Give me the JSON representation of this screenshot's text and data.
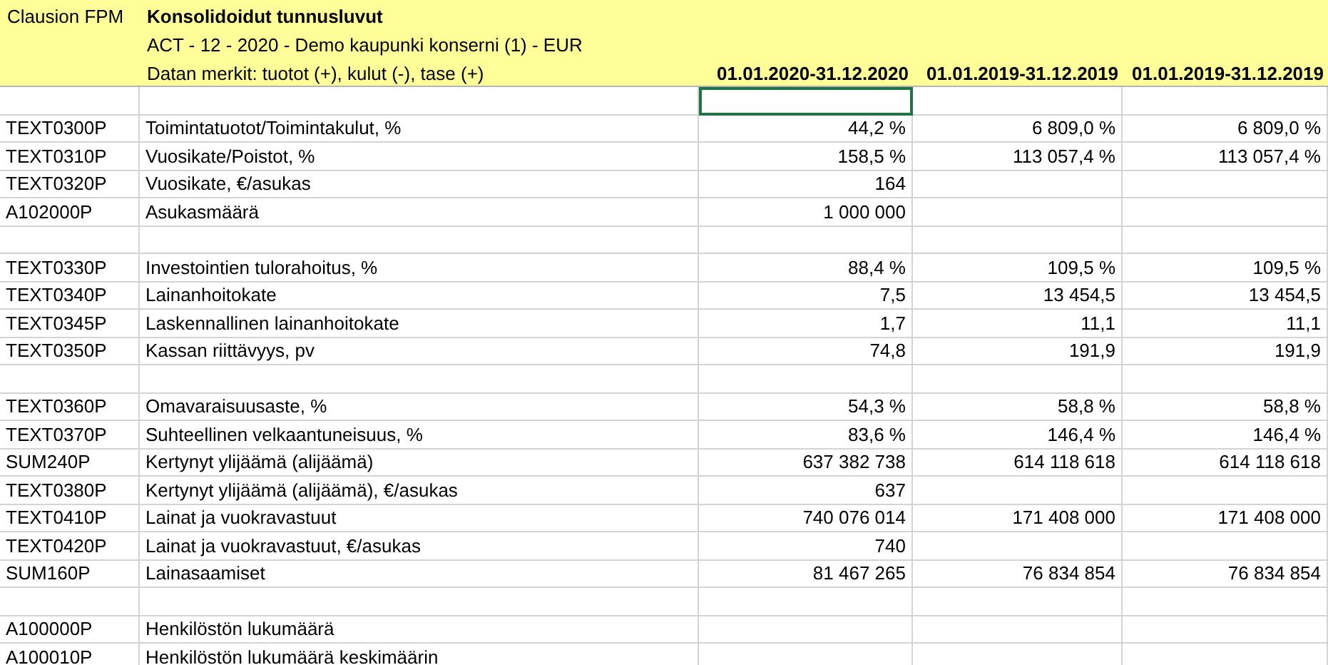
{
  "header": {
    "app": "Clausion FPM",
    "title": "Konsolidoidut tunnusluvut",
    "subtitle": "ACT - 12 - 2020 - Demo kaupunki konserni (1) - EUR",
    "note": "Datan merkit: tuotot (+), kulut (-), tase (+)",
    "columns": [
      "01.01.2020-31.12.2020",
      "01.01.2019-31.12.2019",
      "01.01.2019-31.12.2019"
    ]
  },
  "rows": [
    {
      "kind": "blank",
      "cells": [
        {
          "selected": true
        },
        {
          "selected": false
        },
        {
          "selected": false
        }
      ]
    },
    {
      "kind": "data",
      "code": "TEXT0300P",
      "name": "Toimintatuotot/Toimintakulut, %",
      "values": [
        "44,2 %",
        "6 809,0 %",
        "6 809,0 %"
      ]
    },
    {
      "kind": "data",
      "code": "TEXT0310P",
      "name": "Vuosikate/Poistot, %",
      "values": [
        "158,5 %",
        "113 057,4 %",
        "113 057,4 %"
      ]
    },
    {
      "kind": "data",
      "code": "TEXT0320P",
      "name": "Vuosikate, €/asukas",
      "values": [
        "164"
      ]
    },
    {
      "kind": "data",
      "code": "A102000P",
      "name": "Asukasmäärä",
      "values": [
        "1 000 000"
      ]
    },
    {
      "kind": "blank"
    },
    {
      "kind": "data",
      "code": "TEXT0330P",
      "name": "Investointien tulorahoitus, %",
      "values": [
        "88,4 %",
        "109,5 %",
        "109,5 %"
      ]
    },
    {
      "kind": "data",
      "code": "TEXT0340P",
      "name": "Lainanhoitokate",
      "values": [
        "7,5",
        "13 454,5",
        "13 454,5"
      ]
    },
    {
      "kind": "data",
      "code": "TEXT0345P",
      "name": "Laskennallinen lainanhoitokate",
      "values": [
        "1,7",
        "11,1",
        "11,1"
      ]
    },
    {
      "kind": "data",
      "code": "TEXT0350P",
      "name": "Kassan riittävyys, pv",
      "values": [
        "74,8",
        "191,9",
        "191,9"
      ]
    },
    {
      "kind": "blank"
    },
    {
      "kind": "data",
      "code": "TEXT0360P",
      "name": "Omavaraisuusaste, %",
      "values": [
        "54,3 %",
        "58,8 %",
        "58,8 %"
      ]
    },
    {
      "kind": "data",
      "code": "TEXT0370P",
      "name": "Suhteellinen velkaantuneisuus, %",
      "values": [
        "83,6 %",
        "146,4 %",
        "146,4 %"
      ]
    },
    {
      "kind": "data",
      "code": "SUM240P",
      "name": "Kertynyt ylijäämä (alijäämä)",
      "values": [
        "637 382 738",
        "614 118 618",
        "614 118 618"
      ]
    },
    {
      "kind": "data",
      "code": "TEXT0380P",
      "name": "Kertynyt ylijäämä (alijäämä), €/asukas",
      "values": [
        "637"
      ]
    },
    {
      "kind": "data",
      "code": "TEXT0410P",
      "name": "Lainat ja vuokravastuut",
      "values": [
        "740 076 014",
        "171 408 000",
        "171 408 000"
      ]
    },
    {
      "kind": "data",
      "code": "TEXT0420P",
      "name": "Lainat ja vuokravastuut, €/asukas",
      "values": [
        "740"
      ]
    },
    {
      "kind": "data",
      "code": "SUM160P",
      "name": "Lainasaamiset",
      "values": [
        "81 467 265",
        "76 834 854",
        "76 834 854"
      ]
    },
    {
      "kind": "blank"
    },
    {
      "kind": "data",
      "code": "A100000P",
      "name": "Henkilöstön lukumäärä"
    },
    {
      "kind": "data",
      "code": "A100010P",
      "name": "Henkilöstön lukumäärä keskimäärin"
    }
  ]
}
